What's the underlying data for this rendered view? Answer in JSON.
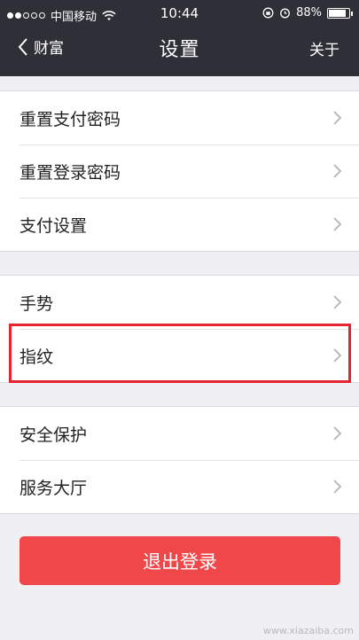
{
  "status_bar": {
    "carrier": "中国移动",
    "time": "10:44",
    "battery": "88%",
    "battery_level": 0.88
  },
  "nav": {
    "back_label": "财富",
    "title": "设置",
    "right_label": "关于"
  },
  "groups": [
    {
      "items": [
        {
          "label": "重置支付密码"
        },
        {
          "label": "重置登录密码"
        },
        {
          "label": "支付设置"
        }
      ]
    },
    {
      "items": [
        {
          "label": "手势"
        },
        {
          "label": "指纹"
        }
      ]
    },
    {
      "items": [
        {
          "label": "安全保护"
        },
        {
          "label": "服务大厅"
        }
      ]
    }
  ],
  "logout_label": "退出登录",
  "watermark": "www.xiazaiba.com",
  "colors": {
    "nav_bg": "#2f3037",
    "logout_bg": "#f0474a",
    "highlight": "#e8232e"
  }
}
